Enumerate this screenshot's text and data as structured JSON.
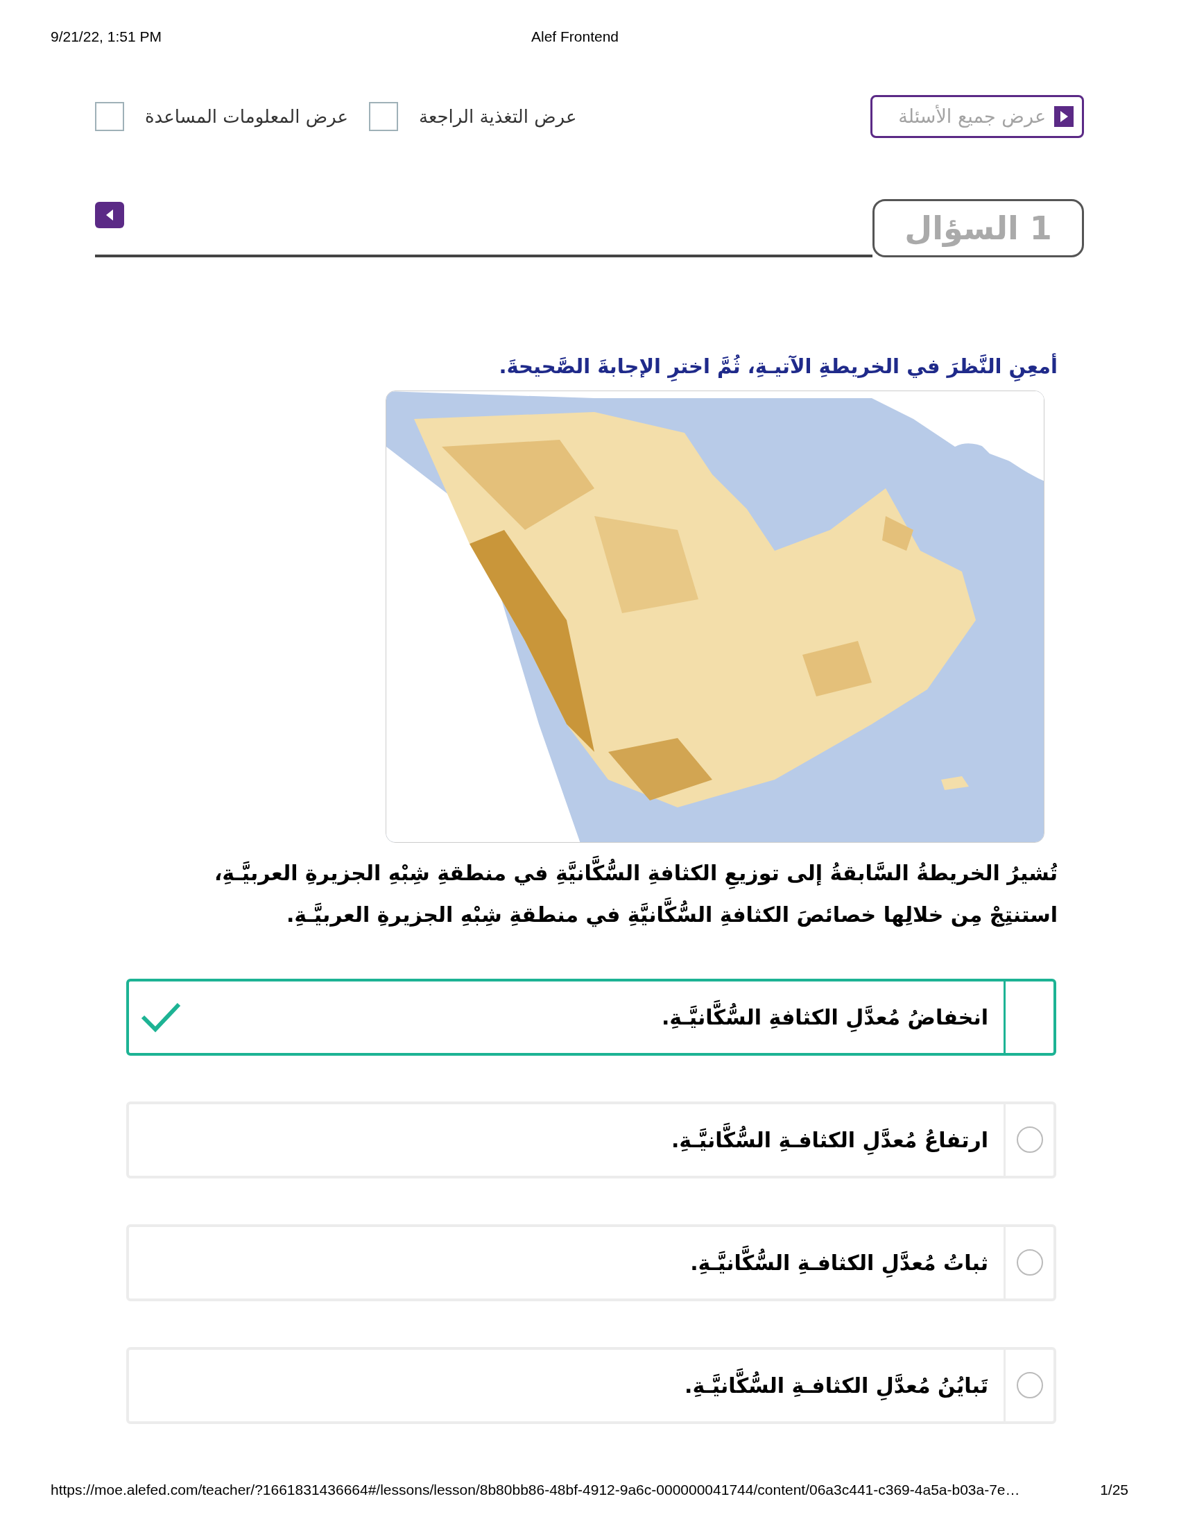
{
  "print_header": {
    "date": "9/21/22, 1:51 PM",
    "title": "Alef Frontend"
  },
  "toolbar": {
    "show_all_button": "عرض جميع الأسئلة",
    "checkboxes": [
      {
        "label": "عرض التغذية الراجعة",
        "checked": false
      },
      {
        "label": "عرض المعلومات المساعدة",
        "checked": false
      }
    ]
  },
  "question_tab": {
    "label": "1 السؤال"
  },
  "instruction": "أمعِنِ النَّظرَ في الخريطةِ الآتيـةِ، ثُمَّ اخترِ الإجابةَ الصَّحيحةَ.",
  "question_text": "تُشيرُ الخريطةُ السَّابقةُ إلى توزيعِ الكثافةِ السُّكَّانيَّةِ في منطقةِ شِبْهِ الجزيرةِ العربيَّـةِ، استنتِجْ مِن خلالِها خصائصَ الكثافةِ السُّكَّانيَّةِ في منطقةِ شِبْهِ الجزيرةِ العربيَّـةِ.",
  "options": [
    {
      "text": "انخفاضُ مُعدَّلِ الكثافةِ السُّكَّانيَّـةِ.",
      "selected": true
    },
    {
      "text": "ارتفاعُ مُعدَّلِ الكثافـةِ السُّكَّانيَّـةِ.",
      "selected": false
    },
    {
      "text": "ثباتُ مُعدَّلِ الكثافـةِ السُّكَّانيَّـةِ.",
      "selected": false
    },
    {
      "text": "تَبايُنُ مُعدَّلِ الكثافـةِ السُّكَّانيَّـةِ.",
      "selected": false
    }
  ],
  "print_footer": {
    "url": "https://moe.alefed.com/teacher/?1661831436664#/lessons/lesson/8b80bb86-48bf-4912-9a6c-000000041744/content/06a3c441-c369-4a5a-b03a-7e…",
    "page": "1/25"
  }
}
